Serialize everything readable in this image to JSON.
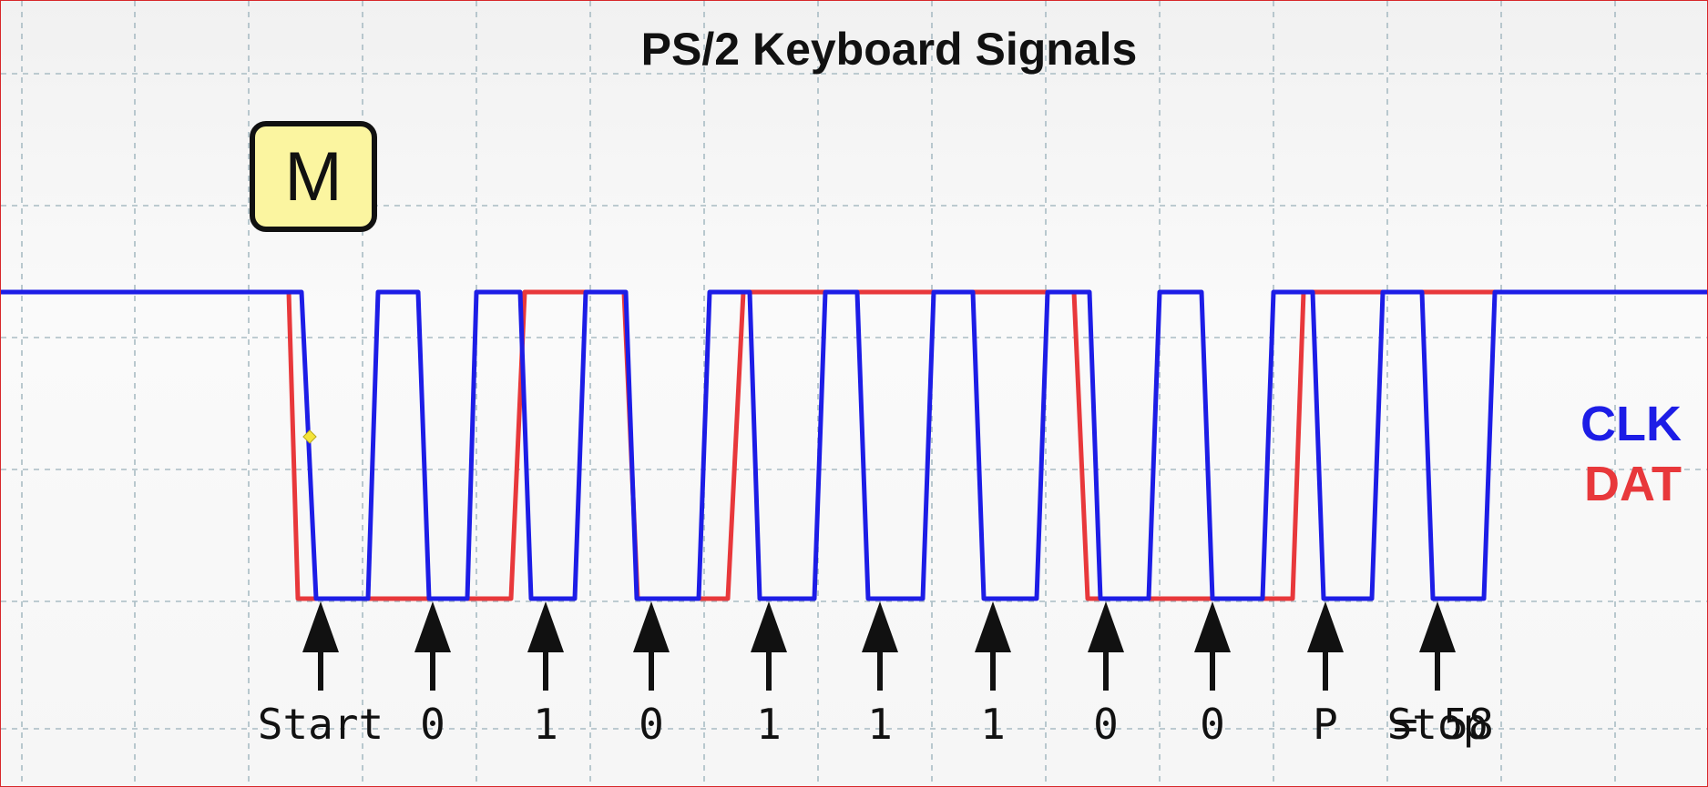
{
  "title": "PS/2 Keyboard Signals",
  "key": "M",
  "legend": [
    {
      "name": "CLK",
      "color": "#1d1de6"
    },
    {
      "name": "DAT",
      "color": "#e8383b"
    }
  ],
  "bits": [
    "Start",
    "0",
    "1",
    "0",
    "1",
    "1",
    "1",
    "0",
    "0",
    "P",
    "Stop"
  ],
  "result": "= 58",
  "colors": {
    "clk": "#1d1de6",
    "dat": "#e8383b",
    "arrow": "#111111",
    "grid": "#a9bcc4"
  }
}
